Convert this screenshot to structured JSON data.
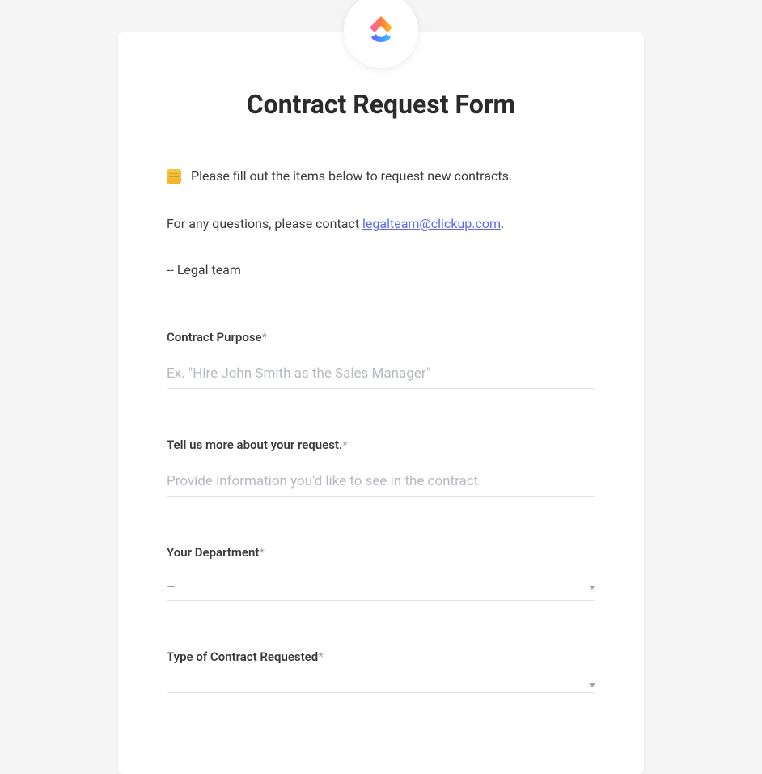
{
  "form": {
    "title": "Contract Request Form",
    "intro": "Please fill out the items below to request new contracts.",
    "contact_prefix": "For any questions, please contact ",
    "contact_email": "legalteam@clickup.com",
    "contact_suffix": ".",
    "signature": "-- Legal team"
  },
  "fields": {
    "purpose": {
      "label": "Contract Purpose",
      "required": "*",
      "placeholder": "Ex. \"Hire John Smith as the Sales Manager\""
    },
    "more": {
      "label": "Tell us more about your request.",
      "required": "*",
      "placeholder": "Provide information you'd like to see in the contract."
    },
    "department": {
      "label": "Your Department",
      "required": "*",
      "value": "–"
    },
    "contract_type": {
      "label": "Type of Contract Requested",
      "required": "*",
      "value": ""
    }
  }
}
